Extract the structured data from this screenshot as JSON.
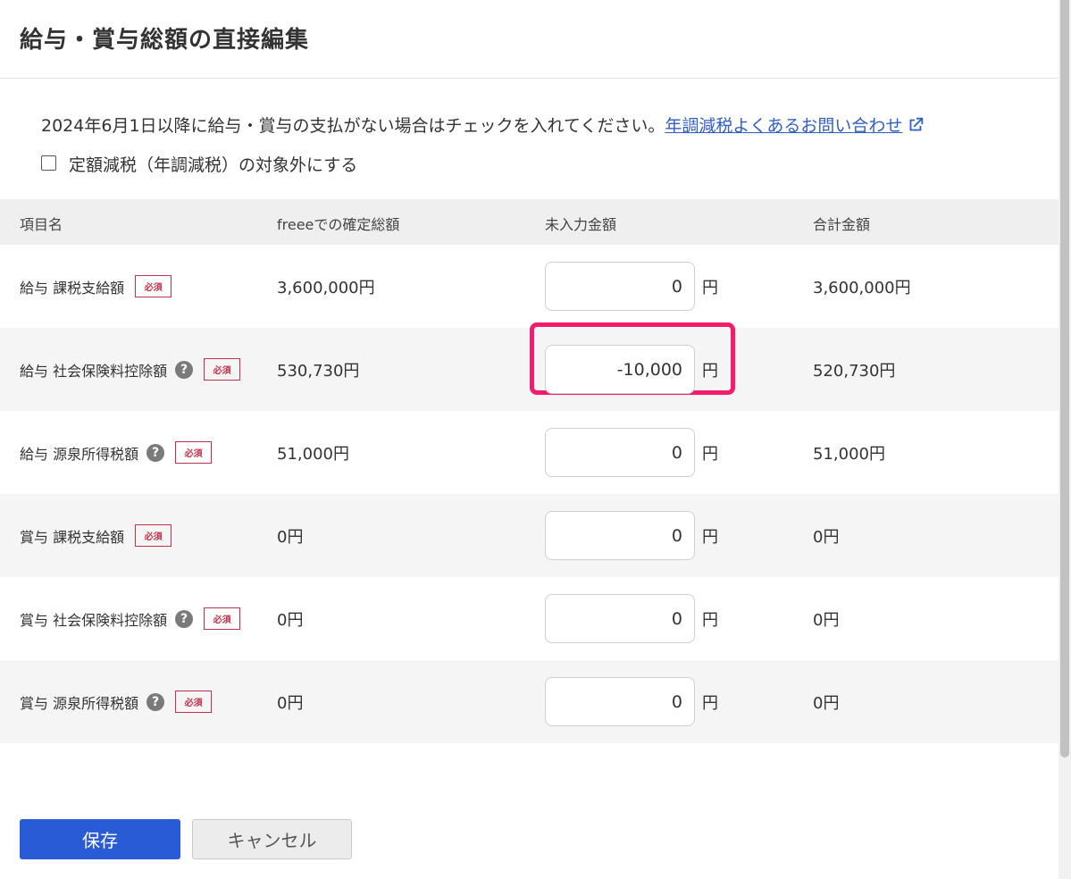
{
  "page_title": "給与・賞与総額の直接編集",
  "notice": {
    "text": "2024年6月1日以降に給与・賞与の支払がない場合はチェックを入れてください。",
    "link_label": "年調減税よくあるお問い合わせ"
  },
  "checkbox": {
    "label": "定額減税（年調減税）の対象外にする",
    "checked": false
  },
  "table": {
    "headers": [
      "項目名",
      "freeeでの確定総額",
      "未入力金額",
      "合計金額"
    ],
    "required_label": "必須",
    "help_glyph": "?",
    "unit": "円",
    "rows": [
      {
        "name": "給与 課税支給額",
        "help": false,
        "confirmed": "3,600,000円",
        "input": "0",
        "total": "3,600,000円"
      },
      {
        "name": "給与 社会保険料控除額",
        "help": true,
        "confirmed": "530,730円",
        "input": "-10,000",
        "total": "520,730円",
        "highlighted": true
      },
      {
        "name": "給与 源泉所得税額",
        "help": true,
        "confirmed": "51,000円",
        "input": "0",
        "total": "51,000円"
      },
      {
        "name": "賞与 課税支給額",
        "help": false,
        "confirmed": "0円",
        "input": "0",
        "total": "0円"
      },
      {
        "name": "賞与 社会保険料控除額",
        "help": true,
        "confirmed": "0円",
        "input": "0",
        "total": "0円"
      },
      {
        "name": "賞与 源泉所得税額",
        "help": true,
        "confirmed": "0円",
        "input": "0",
        "total": "0円"
      }
    ]
  },
  "buttons": {
    "save": "保存",
    "cancel": "キャンセル"
  },
  "colors": {
    "primary": "#2a5bd7",
    "link": "#2f5fc5",
    "required": "#c2324a",
    "highlight": "#f41d6b"
  }
}
